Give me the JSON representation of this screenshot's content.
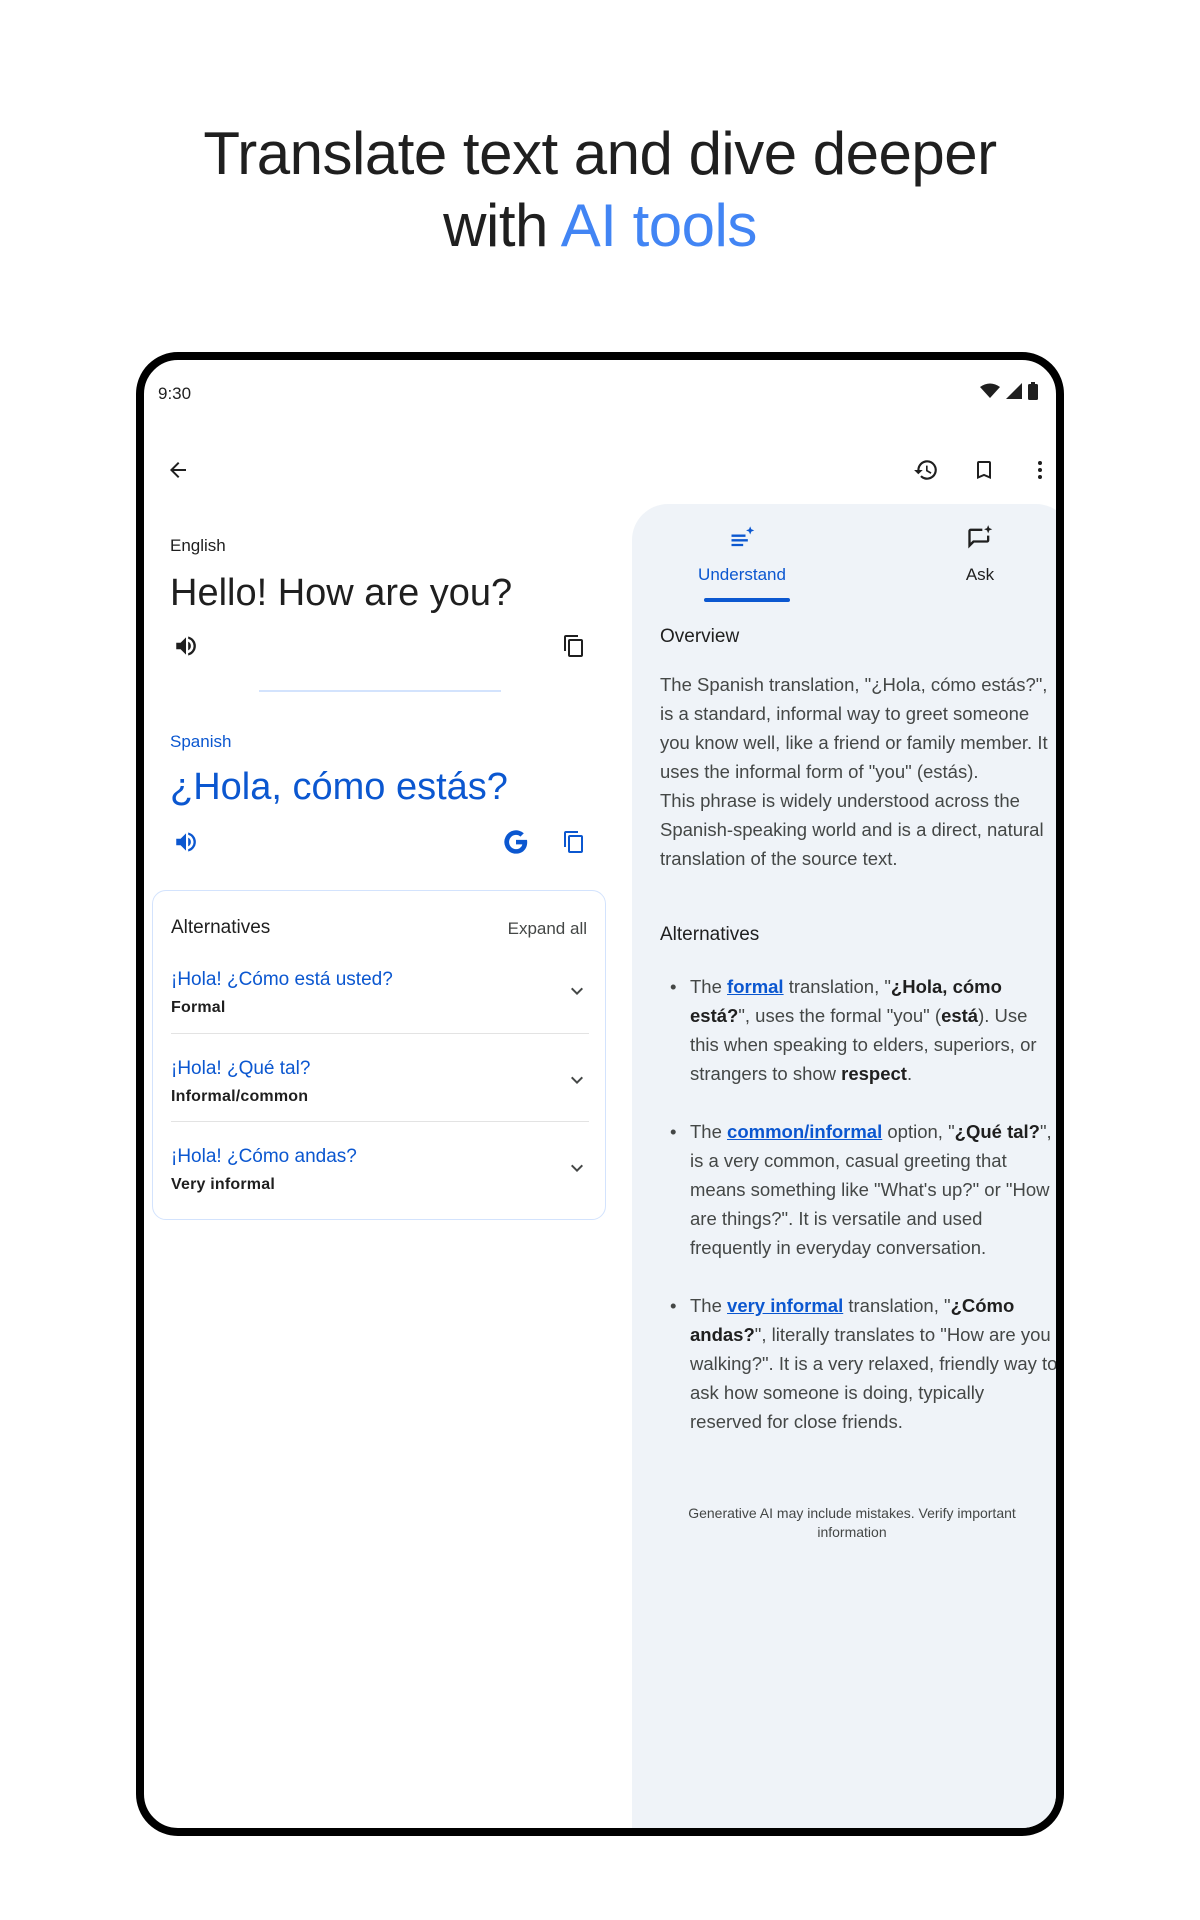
{
  "headline": {
    "line1": "Translate text and dive deeper",
    "line2_prefix": "with ",
    "line2_accent": "AI tools"
  },
  "status": {
    "time": "9:30"
  },
  "appbar": {
    "back_icon": "arrow-back-icon",
    "history_icon": "history-icon",
    "bookmark_icon": "bookmark-icon",
    "more_icon": "more-vert-icon"
  },
  "source": {
    "language": "English",
    "text": "Hello! How are you?"
  },
  "target": {
    "language": "Spanish",
    "text": "¿Hola, cómo estás?"
  },
  "alternatives": {
    "title": "Alternatives",
    "expand_label": "Expand all",
    "items": [
      {
        "phrase": "¡Hola! ¿Cómo está usted?",
        "register": "Formal"
      },
      {
        "phrase": "¡Hola! ¿Qué tal?",
        "register": "Informal/common"
      },
      {
        "phrase": "¡Hola! ¿Cómo andas?",
        "register": "Very informal"
      }
    ]
  },
  "panel": {
    "tabs": [
      {
        "label": "Understand",
        "active": true
      },
      {
        "label": "Ask",
        "active": false
      }
    ],
    "overview_heading": "Overview",
    "overview_p1": "The Spanish translation, \"¿Hola, cómo estás?\", is a standard, informal way to greet someone you know well, like a friend or family member. It uses the informal form of \"you\" (estás).",
    "overview_p2": "This phrase is widely understood across the Spanish-speaking world and is a direct, natural translation of the source text.",
    "alternatives_heading": "Alternatives",
    "bullets": [
      {
        "t1": "The ",
        "link": "formal",
        "t2": " translation, \"",
        "b1": "¿Hola, cómo está?",
        "t3": "\", uses the formal \"you\" (",
        "b2": "está",
        "t4": "). Use this when speaking to elders, superiors, or strangers to show ",
        "b3": "respect",
        "t5": "."
      },
      {
        "t1": "The ",
        "link": "common/informal",
        "t2": " option, \"",
        "b1": "¿Qué tal?",
        "t3": "\", is a very common, casual greeting that means something like \"What's up?\" or \"How are things?\". It is versatile and used frequently in everyday conversation.",
        "b2": "",
        "t4": "",
        "b3": "",
        "t5": ""
      },
      {
        "t1": "The ",
        "link": "very informal",
        "t2": " translation, \"",
        "b1": "¿Cómo andas?",
        "t3": "\", literally translates to \"How are you walking?\". It is a very relaxed, friendly way to ask how someone is doing, typically reserved for close friends.",
        "b2": "",
        "t4": "",
        "b3": "",
        "t5": ""
      }
    ],
    "disclaimer": "Generative AI may include mistakes. Verify important information"
  },
  "colors": {
    "accent": "#4285f4",
    "link_blue": "#0b57d0",
    "panel_bg": "#eff3f8"
  }
}
